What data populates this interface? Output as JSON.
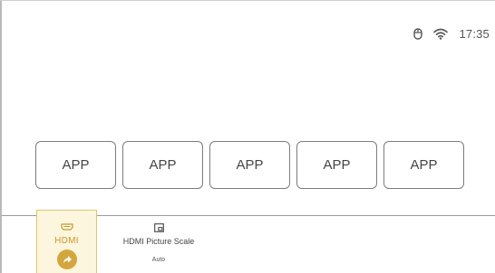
{
  "status_bar": {
    "mouse_icon": "mouse-icon",
    "wifi_icon": "wifi-icon",
    "time": "17:35"
  },
  "apps": [
    {
      "label": "APP"
    },
    {
      "label": "APP"
    },
    {
      "label": "APP"
    },
    {
      "label": "APP"
    },
    {
      "label": "APP"
    }
  ],
  "source": {
    "icon": "hdmi-port-icon",
    "label": "HDMI",
    "action_icon": "share-arrow-icon"
  },
  "settings": [
    {
      "icon": "picture-scale-icon",
      "label": "HDMI Picture Scale",
      "value": "Auto"
    }
  ],
  "colors": {
    "accent": "#d4a63e",
    "accent_text": "#c59a2c",
    "accent_bg": "#fdf6de",
    "tile_border": "#7d7d7d",
    "text": "#444444"
  }
}
